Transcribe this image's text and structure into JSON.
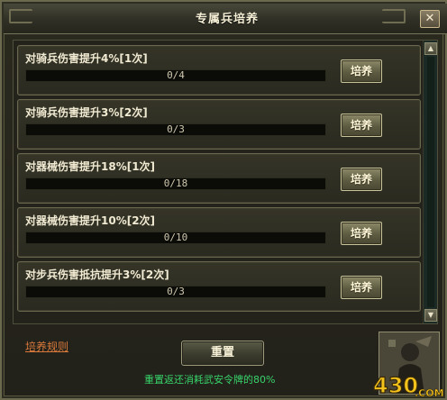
{
  "window": {
    "title": "专属兵培养",
    "close_label": "✕"
  },
  "items": [
    {
      "label": "对骑兵伤害提升4%[1次]",
      "progress_text": "0/4",
      "progress": 0,
      "button": "培养"
    },
    {
      "label": "对骑兵伤害提升3%[2次]",
      "progress_text": "0/3",
      "progress": 0,
      "button": "培养"
    },
    {
      "label": "对器械伤害提升18%[1次]",
      "progress_text": "0/18",
      "progress": 0,
      "button": "培养"
    },
    {
      "label": "对器械伤害提升10%[2次]",
      "progress_text": "0/10",
      "progress": 0,
      "button": "培养"
    },
    {
      "label": "对步兵伤害抵抗提升3%[2次]",
      "progress_text": "0/3",
      "progress": 0,
      "button": "培养"
    }
  ],
  "footer": {
    "rules_link": "培养规则",
    "reset_button": "重置",
    "reset_note": "重置返还消耗武安令牌的80%"
  },
  "branding": {
    "watermark": "430.com"
  },
  "colors": {
    "accent_orange": "#d97a3c",
    "note_green": "#37d46a",
    "button_gold": "#8c8a68"
  }
}
